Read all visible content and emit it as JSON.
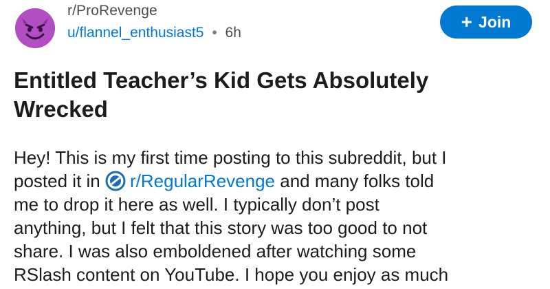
{
  "header": {
    "avatar_icon": "devil-emoji-icon",
    "subreddit": "r/ProRevenge",
    "username": "u/flannel_enthusiast5",
    "separator": "•",
    "age": "6h",
    "join_label": "Join",
    "join_icon": "plus-icon",
    "accent_color": "#0079d3"
  },
  "post": {
    "title_line1": "Entitled Teacher’s Kid Gets Absolutely",
    "title_line2": "Wrecked",
    "body": {
      "line1": "Hey! This is my first time posting to this subreddit, but I",
      "line2_before": "posted it in",
      "line2_link": "r/RegularRevenge",
      "line2_after": "and many folks told",
      "line3": "me to drop it here as well. I typically don’t post",
      "line4": "anything, but I felt that this story was too good to not",
      "line5": "share. I was also emboldened after watching some",
      "line6": "RSlash content on YouTube. I hope you enjoy as much"
    }
  }
}
